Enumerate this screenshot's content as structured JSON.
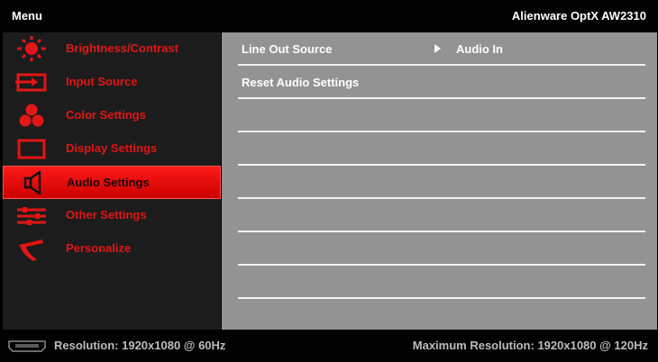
{
  "title_bar": {
    "menu_title": "Menu",
    "model_name": "Alienware OptX AW2310"
  },
  "sidebar": {
    "items": [
      {
        "label": "Brightness/Contrast",
        "icon": "brightness-icon",
        "selected": false
      },
      {
        "label": "Input Source",
        "icon": "input-source-icon",
        "selected": false
      },
      {
        "label": "Color Settings",
        "icon": "color-settings-icon",
        "selected": false
      },
      {
        "label": "Display Settings",
        "icon": "display-settings-icon",
        "selected": false
      },
      {
        "label": "Audio Settings",
        "icon": "speaker-icon",
        "selected": true
      },
      {
        "label": "Other Settings",
        "icon": "other-settings-icon",
        "selected": false
      },
      {
        "label": "Personalize",
        "icon": "personalize-icon",
        "selected": false
      }
    ]
  },
  "content": {
    "rows": [
      {
        "label": "Line Out Source",
        "value": "Audio In"
      },
      {
        "label": "Reset Audio Settings",
        "value": ""
      },
      {
        "label": "",
        "value": ""
      },
      {
        "label": "",
        "value": ""
      },
      {
        "label": "",
        "value": ""
      },
      {
        "label": "",
        "value": ""
      },
      {
        "label": "",
        "value": ""
      },
      {
        "label": "",
        "value": ""
      }
    ]
  },
  "status_bar": {
    "connector_icon": "hdmi-connector-icon",
    "resolution": "Resolution: 1920x1080 @ 60Hz",
    "max_resolution": "Maximum Resolution: 1920x1080 @ 120Hz"
  },
  "colors": {
    "accent_red": "#e31515",
    "selected_bg": "#e80000",
    "sidebar_bg": "#1c1c1c",
    "content_bg": "#939393"
  }
}
